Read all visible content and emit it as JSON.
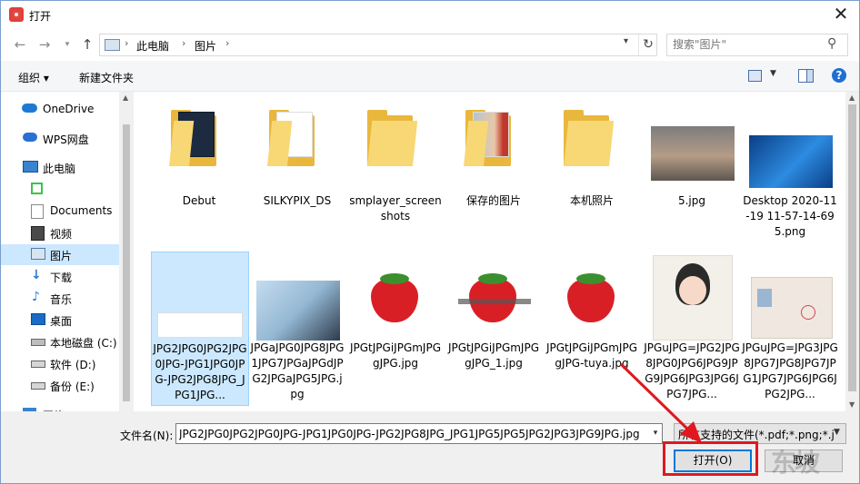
{
  "window": {
    "title": "打开"
  },
  "address": {
    "breadcrumbs": [
      "此电脑",
      "图片"
    ],
    "search_placeholder": "搜索\"图片\""
  },
  "toolbar": {
    "organize_label": "组织 ▾",
    "new_folder_label": "新建文件夹"
  },
  "sidebar": {
    "items": [
      {
        "label": "OneDrive",
        "icon": "cloud-icon"
      },
      {
        "label": "WPS网盘",
        "icon": "wps-cloud-icon"
      },
      {
        "label": "此电脑",
        "icon": "computer-icon"
      },
      {
        "label": "",
        "icon": "green-app-icon"
      },
      {
        "label": "Documents",
        "icon": "documents-icon"
      },
      {
        "label": "视频",
        "icon": "video-icon"
      },
      {
        "label": "图片",
        "icon": "pictures-icon",
        "selected": true
      },
      {
        "label": "下载",
        "icon": "download-icon"
      },
      {
        "label": "音乐",
        "icon": "music-icon"
      },
      {
        "label": "桌面",
        "icon": "desktop-icon"
      },
      {
        "label": "本地磁盘 (C:)",
        "icon": "drive-icon"
      },
      {
        "label": "软件 (D:)",
        "icon": "drive-icon"
      },
      {
        "label": "备份 (E:)",
        "icon": "drive-icon"
      },
      {
        "label": "网络",
        "icon": "network-icon"
      }
    ]
  },
  "files": [
    {
      "name": "Debut",
      "kind": "folder"
    },
    {
      "name": "SILKYPIX_DS",
      "kind": "folder"
    },
    {
      "name": "smplayer_screenshots",
      "kind": "folder"
    },
    {
      "name": "保存的图片",
      "kind": "folder"
    },
    {
      "name": "本机照片",
      "kind": "folder"
    },
    {
      "name": "5.jpg",
      "kind": "image"
    },
    {
      "name": "Desktop 2020-11-19 11-57-14-695.png",
      "kind": "image"
    },
    {
      "name": "JPG2JPG0JPG2JPG0JPG-JPG1JPG0JPG-JPG2JPG8JPG_JPG1JPG...",
      "kind": "image",
      "selected": true
    },
    {
      "name": "JPGaJPG0JPG8JPG1JPG7JPGaJPGdJPG2JPGaJPG5JPG.jpg",
      "kind": "image"
    },
    {
      "name": "JPGtJPGiJPGmJPGgJPG.jpg",
      "kind": "image"
    },
    {
      "name": "JPGtJPGiJPGmJPGgJPG_1.jpg",
      "kind": "image"
    },
    {
      "name": "JPGtJPGiJPGmJPGgJPG-tuya.jpg",
      "kind": "image"
    },
    {
      "name": "JPGuJPG=JPG2JPG8JPG0JPG6JPG9JPG9JPG6JPG3JPG6JPG7JPG...",
      "kind": "image"
    },
    {
      "name": "JPGuJPG=JPG3JPG8JPG7JPG8JPG7JPG1JPG7JPG6JPG6JPG2JPG...",
      "kind": "image"
    }
  ],
  "footer": {
    "filename_label": "文件名(N):",
    "filename_value": "JPG2JPG0JPG2JPG0JPG-JPG1JPG0JPG-JPG2JPG8JPG_JPG1JPG5JPG5JPG2JPG3JPG9JPG.jpg",
    "filetype_value": "所有支持的文件(*.pdf;*.png;*.j",
    "open_label": "打开(O)",
    "cancel_label": "取消"
  },
  "colors": {
    "selection": "#cce8ff",
    "accent": "#0078d7",
    "highlight": "#e0181f",
    "folder": "#f8d775"
  }
}
